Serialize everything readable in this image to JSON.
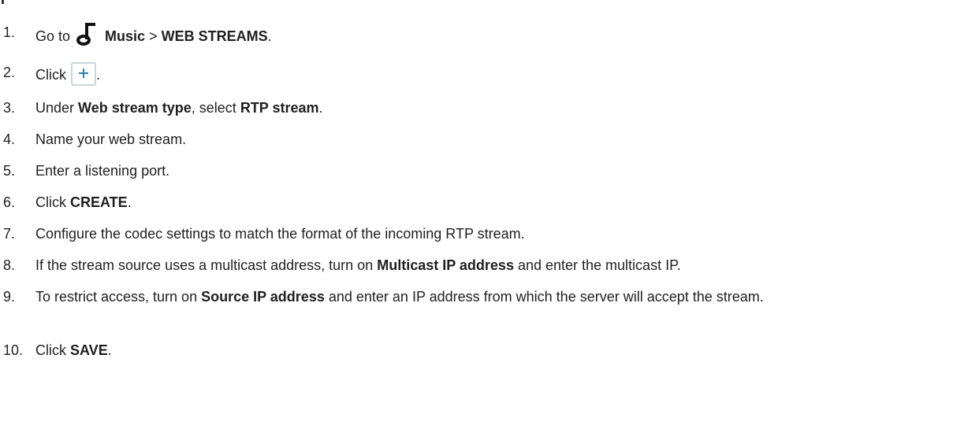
{
  "steps": [
    {
      "num": "1.",
      "pre": "Go to",
      "b1": "Music",
      "mid": ">",
      "b2": "WEB STREAMS",
      "post": "."
    },
    {
      "num": "2.",
      "pre": "Click",
      "post": "."
    },
    {
      "num": "3.",
      "pre": "Under",
      "b1": "Web stream type",
      "mid": ", select",
      "b2": "RTP stream",
      "post": "."
    },
    {
      "num": "4.",
      "pre": "Name your web stream."
    },
    {
      "num": "5.",
      "pre": "Enter a listening port."
    },
    {
      "num": "6.",
      "pre": "Click",
      "b1": "CREATE",
      "post": "."
    },
    {
      "num": "7.",
      "pre": "Configure the codec settings to match the format of the incoming RTP stream."
    },
    {
      "num": "8.",
      "pre": "If the stream source uses a multicast address, turn on",
      "b1": "Multicast IP address",
      "post": "and enter the multicast IP."
    },
    {
      "num": "9.",
      "pre": "To restrict access, turn on",
      "b1": "Source IP address",
      "post": "and enter an IP address from which the server will accept the stream."
    },
    {
      "num": "10.",
      "pre": "Click",
      "b1": "SAVE",
      "post": "."
    }
  ],
  "icons": {
    "music": "music-note-icon",
    "add": "plus-icon",
    "accent": "#2d82a6"
  }
}
